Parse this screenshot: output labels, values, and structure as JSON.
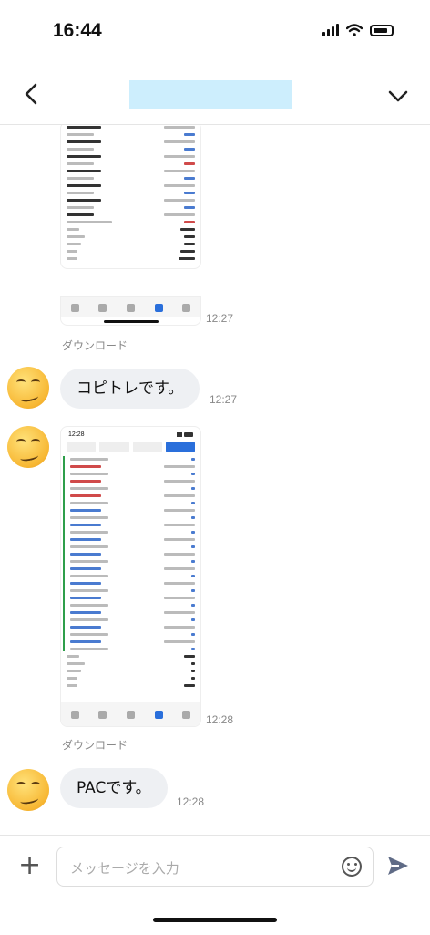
{
  "status_bar": {
    "time": "16:44"
  },
  "header": {
    "title": ""
  },
  "messages": [
    {
      "type": "image",
      "time": "12:27",
      "download_label": "ダウンロード"
    },
    {
      "type": "text",
      "text": "コピトレです。",
      "time": "12:27"
    },
    {
      "type": "image",
      "time": "12:28",
      "download_label": "ダウンロード",
      "thumb_time": "12:28"
    },
    {
      "type": "text",
      "text": "PACです。",
      "time": "12:28"
    }
  ],
  "input": {
    "placeholder": "メッセージを入力"
  },
  "icons": {
    "back": "chevron-left-icon",
    "dropdown": "chevron-down-icon",
    "add": "plus-icon",
    "emoji": "smile-icon",
    "send": "send-icon"
  }
}
